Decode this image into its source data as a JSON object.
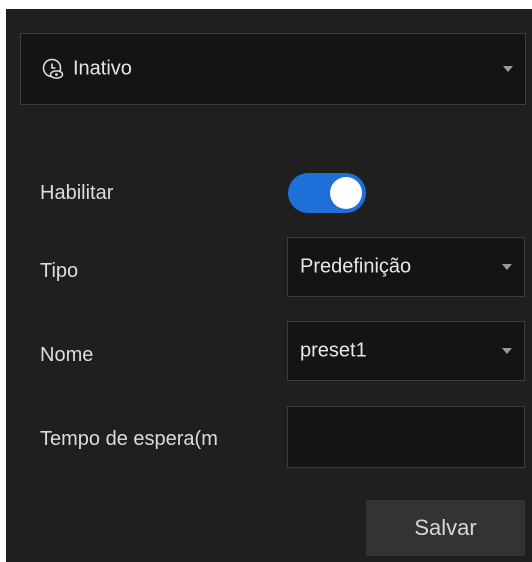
{
  "status": {
    "icon": "clock-eye-icon",
    "selected": "Inativo"
  },
  "form": {
    "enable_label": "Habilitar",
    "enabled": true,
    "type_label": "Tipo",
    "type_value": "Predefinição",
    "name_label": "Nome",
    "name_value": "preset1",
    "wait_label": "Tempo de espera(m",
    "wait_value": ""
  },
  "actions": {
    "save_label": "Salvar"
  },
  "colors": {
    "accent": "#1e6fd8",
    "panel_bg": "#1f1f1f",
    "field_bg": "#141414",
    "button_bg": "#333333"
  }
}
